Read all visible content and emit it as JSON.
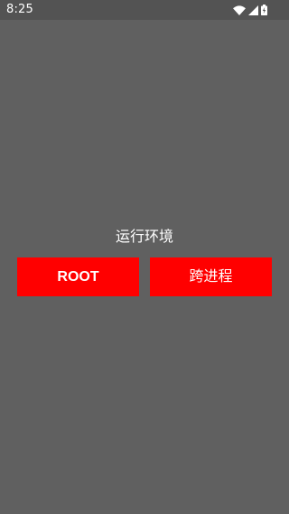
{
  "status_bar": {
    "time": "8:25",
    "icons": [
      "wifi-icon",
      "signal-icon",
      "battery-charging-icon"
    ]
  },
  "main": {
    "section_label": "运行环境",
    "buttons": [
      {
        "label": "ROOT"
      },
      {
        "label": "跨进程"
      }
    ]
  },
  "colors": {
    "background": "#606060",
    "status_bar": "#535353",
    "button": "#ff0000",
    "text": "#ffffff"
  }
}
